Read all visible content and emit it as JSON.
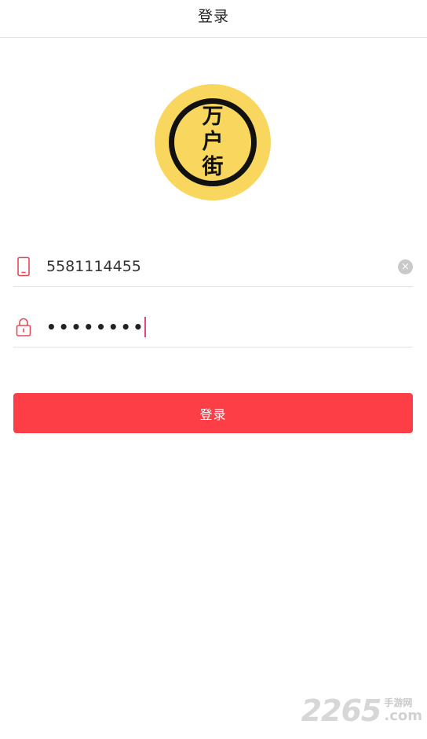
{
  "header": {
    "title": "登录"
  },
  "logo": {
    "lines": [
      "万",
      "户",
      "街"
    ]
  },
  "form": {
    "phone": {
      "value": "5581114455",
      "icon": "phone-icon",
      "clear_icon": "clear-icon",
      "clear_glyph": "×"
    },
    "password": {
      "masked_value": "••••••••",
      "icon": "lock-icon"
    },
    "submit_label": "登录"
  },
  "colors": {
    "accent": "#fd3e47",
    "logo_bg": "#f9d75f",
    "icon_red": "#e34a55",
    "caret": "#e0457b"
  },
  "watermark": {
    "digits": "2265",
    "cn": "手游网",
    "com": ".com"
  }
}
